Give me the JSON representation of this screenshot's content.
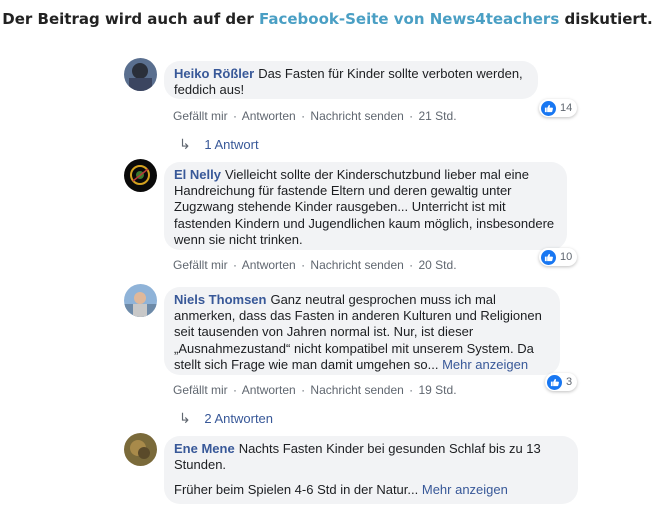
{
  "header": {
    "prefix": "Der Beitrag wird auch auf der",
    "link": "Facebook-Seite von News4teachers",
    "suffix": "diskutiert."
  },
  "actions": {
    "like": "Gefällt mir",
    "reply": "Antworten",
    "message": "Nachricht senden",
    "separator": "·"
  },
  "comments": [
    {
      "author": "Heiko Rößler",
      "text": "Das Fasten für Kinder sollte verboten werden, feddich aus!",
      "time": "21 Std.",
      "likes": "14",
      "replies": "1 Antwort"
    },
    {
      "author": "El Nelly",
      "text": "Vielleicht sollte der Kinderschutzbund lieber mal eine Handreichung für fastende Eltern und deren gewaltig unter Zugzwang stehende Kinder rausgeben... Unterricht ist mit fastenden Kindern und Jugendlichen kaum möglich, insbesondere wenn sie nicht trinken.",
      "time": "20 Std.",
      "likes": "10"
    },
    {
      "author": "Niels Thomsen",
      "text": "Ganz neutral gesprochen muss ich mal anmerken, dass das Fasten in anderen Kulturen und Religionen seit tausenden von Jahren normal ist. Nur, ist dieser „Ausnahmezustand“ nicht kompatibel mit unserem System. Da stellt sich Frage wie man damit umgehen so...",
      "more": "Mehr anzeigen",
      "time": "19 Std.",
      "likes": "3",
      "replies": "2 Antworten"
    },
    {
      "author": "Ene Mene",
      "text": "Nachts Fasten Kinder bei gesunden Schlaf bis zu 13 Stunden.",
      "text2": "Früher beim Spielen 4-6 Std in der Natur...",
      "more": "Mehr anzeigen"
    }
  ],
  "colors": {
    "link": "#4a9fc4",
    "author": "#385898",
    "bubble": "#f2f3f5",
    "like": "#1877f2"
  }
}
